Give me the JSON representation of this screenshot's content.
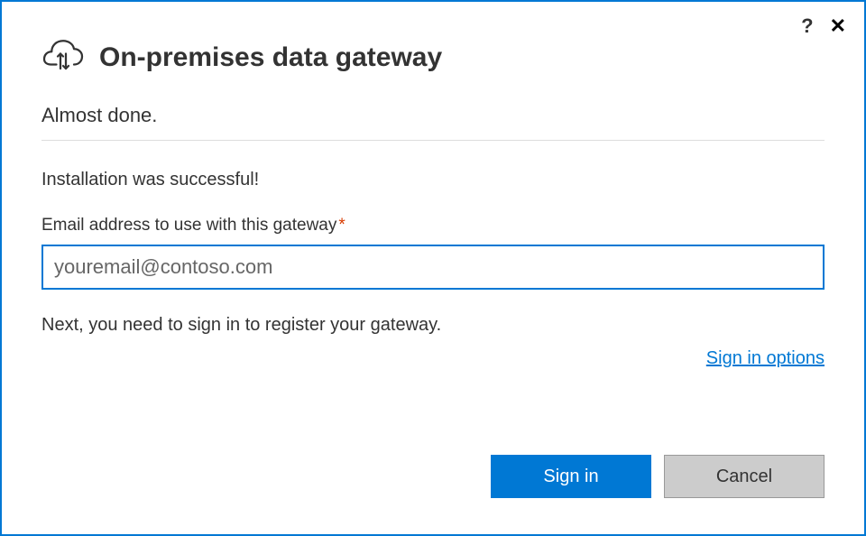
{
  "header": {
    "title": "On-premises data gateway",
    "subtitle": "Almost done."
  },
  "status": "Installation was successful!",
  "email_field": {
    "label": "Email address to use with this gateway",
    "required_mark": "*",
    "value": "youremail@contoso.com"
  },
  "instruction": "Next, you need to sign in to register your gateway.",
  "links": {
    "sign_in_options": "Sign in options"
  },
  "buttons": {
    "sign_in": "Sign in",
    "cancel": "Cancel"
  },
  "titlebar": {
    "help": "?",
    "close": "✕"
  }
}
